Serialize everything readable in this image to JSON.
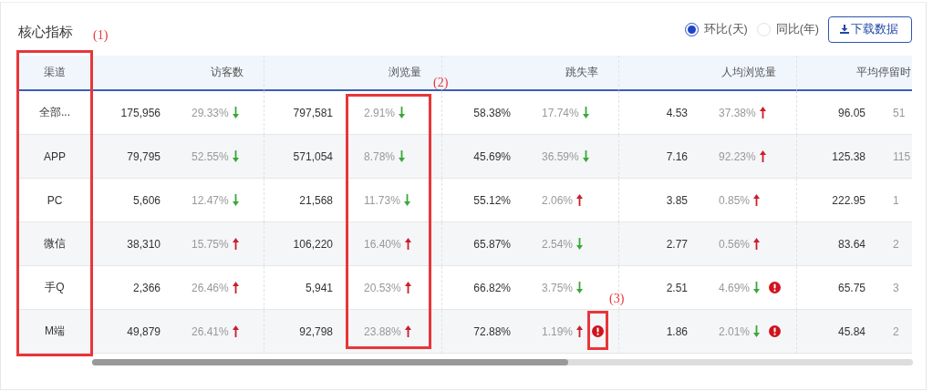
{
  "title": "核心指标",
  "compare_options": [
    {
      "label": "环比(天)",
      "selected": true
    },
    {
      "label": "同比(年)",
      "selected": false
    }
  ],
  "download_button": {
    "label": "下载数据"
  },
  "table": {
    "columns": [
      "渠道",
      "访客数",
      "浏览量",
      "跳失率",
      "人均浏览量",
      "平均停留时"
    ],
    "rows": [
      {
        "channel": "全部...",
        "metrics": [
          {
            "value": "175,956",
            "change": "29.33%",
            "up": false,
            "alert": false
          },
          {
            "value": "797,581",
            "change": "2.91%",
            "up": false,
            "alert": false
          },
          {
            "value": "58.38%",
            "change": "17.74%",
            "up": false,
            "alert": false
          },
          {
            "value": "4.53",
            "change": "37.38%",
            "up": true,
            "alert": false
          },
          {
            "value": "96.05",
            "change": "51"
          }
        ]
      },
      {
        "channel": "APP",
        "metrics": [
          {
            "value": "79,795",
            "change": "52.55%",
            "up": false,
            "alert": false
          },
          {
            "value": "571,054",
            "change": "8.78%",
            "up": false,
            "alert": false
          },
          {
            "value": "45.69%",
            "change": "36.59%",
            "up": false,
            "alert": false
          },
          {
            "value": "7.16",
            "change": "92.23%",
            "up": true,
            "alert": false
          },
          {
            "value": "125.38",
            "change": "115"
          }
        ]
      },
      {
        "channel": "PC",
        "metrics": [
          {
            "value": "5,606",
            "change": "12.47%",
            "up": false,
            "alert": false
          },
          {
            "value": "21,568",
            "change": "11.73%",
            "up": false,
            "alert": false
          },
          {
            "value": "55.12%",
            "change": "2.06%",
            "up": true,
            "alert": false
          },
          {
            "value": "3.85",
            "change": "0.85%",
            "up": true,
            "alert": false
          },
          {
            "value": "222.95",
            "change": "1"
          }
        ]
      },
      {
        "channel": "微信",
        "metrics": [
          {
            "value": "38,310",
            "change": "15.75%",
            "up": true,
            "alert": false
          },
          {
            "value": "106,220",
            "change": "16.40%",
            "up": true,
            "alert": false
          },
          {
            "value": "65.87%",
            "change": "2.54%",
            "up": false,
            "alert": false
          },
          {
            "value": "2.77",
            "change": "0.56%",
            "up": true,
            "alert": false
          },
          {
            "value": "83.64",
            "change": "2"
          }
        ]
      },
      {
        "channel": "手Q",
        "metrics": [
          {
            "value": "2,366",
            "change": "26.46%",
            "up": true,
            "alert": false
          },
          {
            "value": "5,941",
            "change": "20.53%",
            "up": true,
            "alert": false
          },
          {
            "value": "66.82%",
            "change": "3.75%",
            "up": false,
            "alert": false
          },
          {
            "value": "2.51",
            "change": "4.69%",
            "up": false,
            "alert": true
          },
          {
            "value": "65.75",
            "change": "3"
          }
        ]
      },
      {
        "channel": "M端",
        "metrics": [
          {
            "value": "49,879",
            "change": "26.41%",
            "up": true,
            "alert": false
          },
          {
            "value": "92,798",
            "change": "23.88%",
            "up": true,
            "alert": false
          },
          {
            "value": "72.88%",
            "change": "1.19%",
            "up": true,
            "alert": true
          },
          {
            "value": "1.86",
            "change": "2.01%",
            "up": false,
            "alert": true
          },
          {
            "value": "45.84",
            "change": "2"
          }
        ]
      }
    ]
  },
  "annotations": [
    {
      "label": "(1)",
      "kind": "channel-column"
    },
    {
      "label": "(2)",
      "kind": "change-column"
    },
    {
      "label": "(3)",
      "kind": "alert-icon"
    }
  ]
}
